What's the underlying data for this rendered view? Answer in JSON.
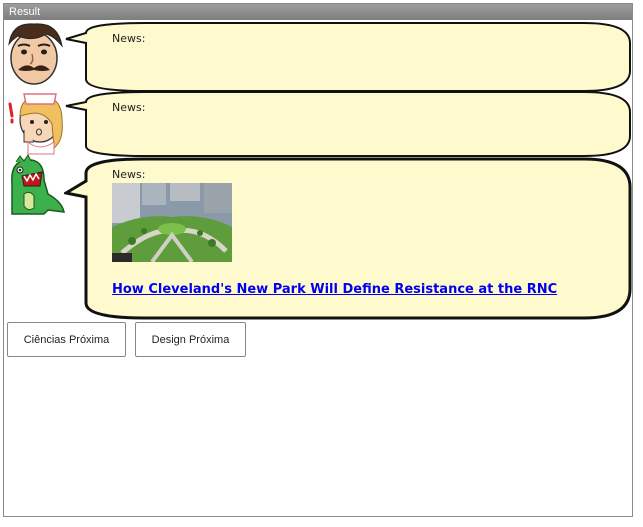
{
  "window": {
    "title": "Result"
  },
  "chat": [
    {
      "avatar": "man-with-mustache-avatar",
      "label": "News:"
    },
    {
      "avatar": "nurse-girl-avatar",
      "label": "News:"
    },
    {
      "avatar": "green-dinosaur-avatar",
      "label": "News:",
      "image": "city-park-aerial-photo",
      "headline": "How Cleveland's New Park Will Define Resistance at the RNC"
    }
  ],
  "buttons": {
    "sciences_next": "Ciências Próxima",
    "design_next": "Design Próxima"
  },
  "colors": {
    "bubble_fill": "#fffacd",
    "link": "#0000ee",
    "titlebar": "#8c8c8c"
  }
}
